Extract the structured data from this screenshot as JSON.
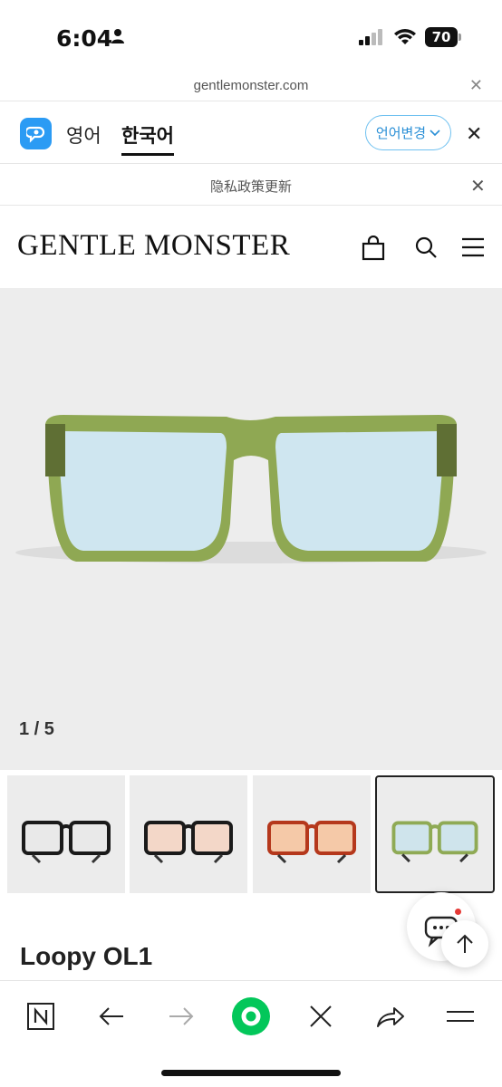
{
  "status_bar": {
    "time": "6:04",
    "battery": "70"
  },
  "browser": {
    "url": "gentlemonster.com"
  },
  "translate_bar": {
    "source_lang": "영어",
    "target_lang": "한국어",
    "change_label": "언어변경"
  },
  "notice": {
    "text": "隐私政策更新"
  },
  "site": {
    "brand": "GENTLE MONSTER"
  },
  "product": {
    "image_counter": "1 / 5",
    "title": "Loopy OL1",
    "thumbnails": [
      {
        "frame_color": "#1a1a1a",
        "lens_color": "#e9e9e9",
        "selected": false
      },
      {
        "frame_color": "#1a1a1a",
        "lens_color": "#f3d7c8",
        "selected": false
      },
      {
        "frame_color": "#b5381c",
        "lens_color": "#f5c9a8",
        "selected": false
      },
      {
        "frame_color": "#8faa55",
        "lens_color": "#cfe4ec",
        "selected": true
      }
    ]
  },
  "colors": {
    "accent_blue": "#2a8fd6",
    "frame_green": "#8fa853",
    "lens_blue": "#cfe6f0",
    "naver_green": "#03c75a"
  }
}
